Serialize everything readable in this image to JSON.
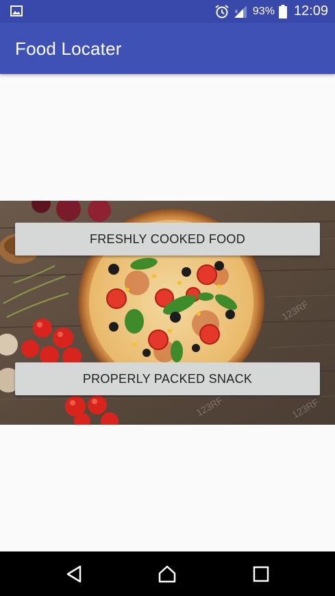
{
  "status_bar": {
    "battery_percent": "93%",
    "time": "12:09",
    "icons": [
      "gallery-icon",
      "alarm-icon",
      "signal-icon",
      "battery-icon"
    ]
  },
  "app_bar": {
    "title": "Food Locater"
  },
  "buttons": {
    "fresh_food": "FRESHLY COOKED FOOD",
    "packed_snack": "PROPERLY PACKED SNACK"
  },
  "nav_bar": {
    "icons": [
      "back-icon",
      "home-icon",
      "recents-icon"
    ]
  },
  "colors": {
    "status_bar": "#3949ab",
    "app_bar": "#3f51b5",
    "button_bg": "#d6d7d7",
    "background": "#fafafa"
  }
}
